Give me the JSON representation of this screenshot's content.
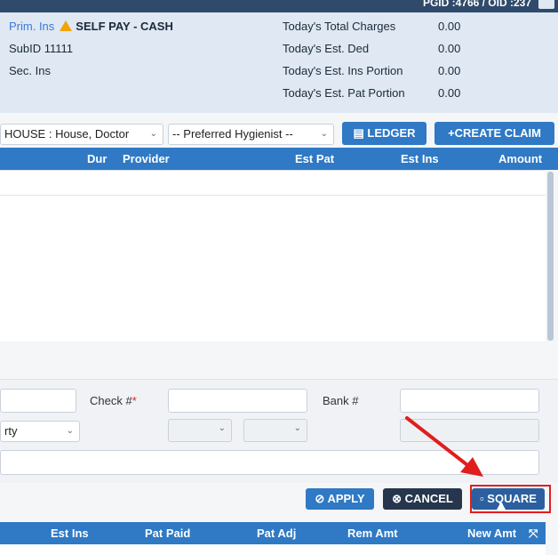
{
  "topbar": {
    "ids": "PGID :4766 / OID :237"
  },
  "info": {
    "prim_ins_label": "Prim. Ins",
    "prim_ins_value": "SELF PAY - CASH",
    "subid": "SubID 11111",
    "sec_ins": "Sec. Ins",
    "charges": [
      {
        "label": "Today's Total Charges",
        "value": "0.00"
      },
      {
        "label": "Today's Est. Ded",
        "value": "0.00"
      },
      {
        "label": "Today's Est. Ins Portion",
        "value": "0.00"
      },
      {
        "label": "Today's Est. Pat Portion",
        "value": "0.00"
      }
    ]
  },
  "toolbar": {
    "provider_select": "HOUSE : House, Doctor",
    "hygienist_select": "-- Preferred Hygienist --",
    "ledger_label": "LEDGER",
    "create_claim_label": "CREATE CLAIM"
  },
  "table1": {
    "headers": [
      "Dur",
      "Provider",
      "Est Pat",
      "Est Ins",
      "Amount"
    ]
  },
  "payment": {
    "check_label": "Check #",
    "check_req": "*",
    "bank_label": "Bank #",
    "party_select": "rty",
    "apply_label": "APPLY",
    "cancel_label": "CANCEL",
    "square_label": "SQUARE"
  },
  "table2": {
    "headers": [
      "Est Ins",
      "Pat Paid",
      "Pat Adj",
      "Rem Amt",
      "New Amt"
    ]
  },
  "colors": {
    "accent": "#2f79c5",
    "dark": "#25364d",
    "annotation": "#e01e1e"
  }
}
